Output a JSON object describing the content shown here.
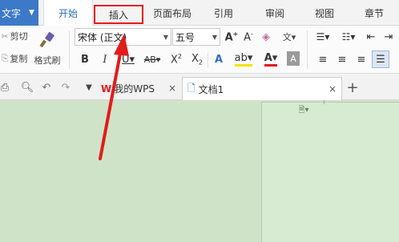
{
  "app": {
    "menu_label": "文字"
  },
  "tabs": [
    {
      "label": "开始"
    },
    {
      "label": "插入"
    },
    {
      "label": "页面布局"
    },
    {
      "label": "引用"
    },
    {
      "label": "审阅"
    },
    {
      "label": "视图"
    },
    {
      "label": "章节"
    }
  ],
  "clipboard": {
    "cut": "剪切",
    "copy": "复制",
    "format_painter": "格式刷"
  },
  "font": {
    "name": "宋体 (正文)",
    "size": "五号"
  },
  "doc_tabs": [
    {
      "label": "我的WPS"
    },
    {
      "label": "文档1"
    }
  ],
  "colors": {
    "accent": "#2f6cc5",
    "highlight_box": "#e21b1b",
    "arrow": "#e21b1b",
    "background": "#cfe3c9"
  }
}
